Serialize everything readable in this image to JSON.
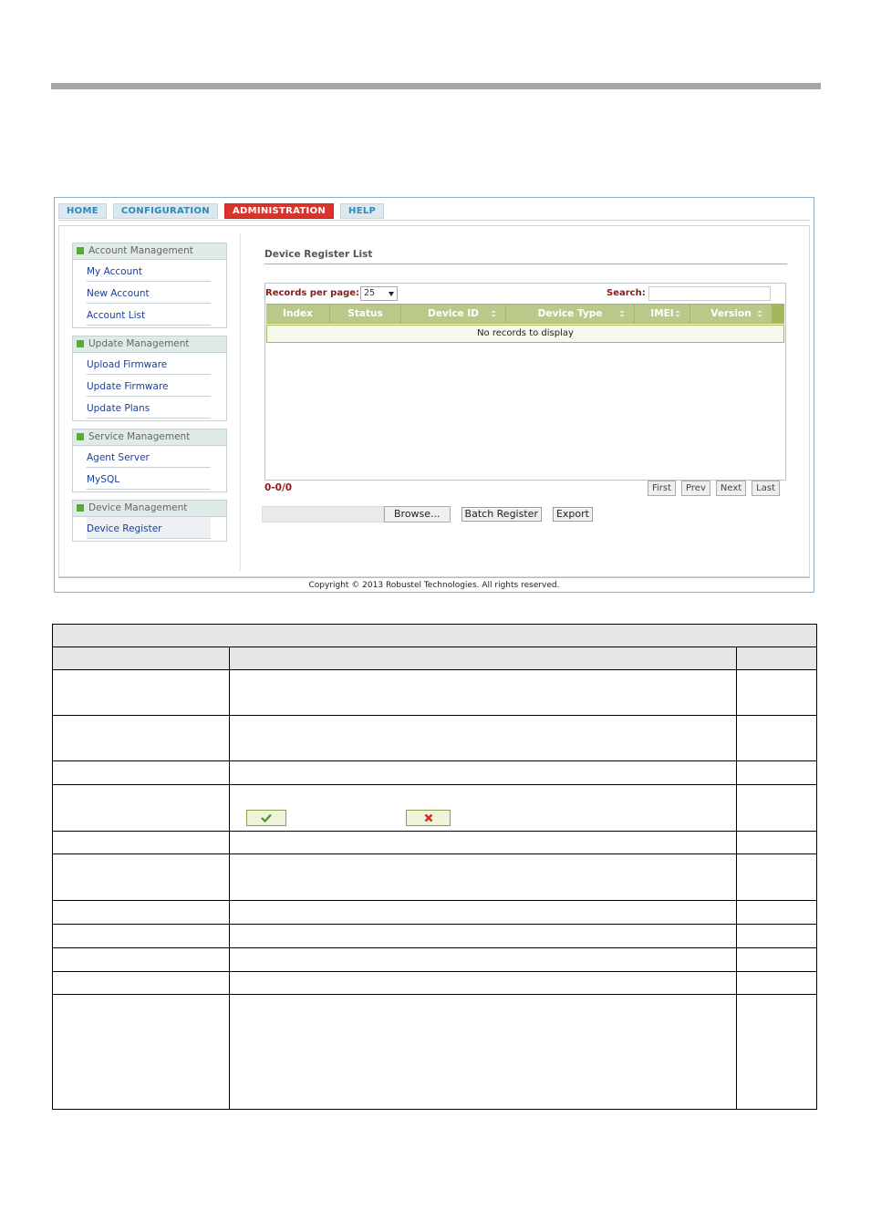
{
  "nav": {
    "tabs": [
      {
        "label": "HOME"
      },
      {
        "label": "CONFIGURATION"
      },
      {
        "label": "ADMINISTRATION"
      },
      {
        "label": "HELP"
      }
    ]
  },
  "sidebar": {
    "groups": [
      {
        "title": "Account Management",
        "items": [
          "My Account",
          "New Account",
          "Account List"
        ]
      },
      {
        "title": "Update Management",
        "items": [
          "Upload Firmware",
          "Update Firmware",
          "Update Plans"
        ]
      },
      {
        "title": "Service Management",
        "items": [
          "Agent Server",
          "MySQL"
        ]
      },
      {
        "title": "Device Management",
        "items": [
          "Device Register"
        ]
      }
    ]
  },
  "main": {
    "title": "Device Register List",
    "records_label": "Records per page:",
    "records_value": "25",
    "search_label": "Search:",
    "columns": [
      "Index",
      "Status",
      "Device ID",
      "Device Type",
      "IMEI",
      "Version"
    ],
    "empty_text": "No records to display",
    "pager_text": "0-0/0",
    "pager_buttons": [
      "First",
      "Prev",
      "Next",
      "Last"
    ],
    "browse_label": "Browse...",
    "batch_label": "Batch Register",
    "export_label": "Export"
  },
  "footer": {
    "copyright": "Copyright © 2013 Robustel Technologies. All rights reserved."
  },
  "colors": {
    "accent": "#d9342b",
    "tab_text": "#2a8bc0",
    "header_green": "#b9c98a",
    "link": "#1a3f9a"
  }
}
